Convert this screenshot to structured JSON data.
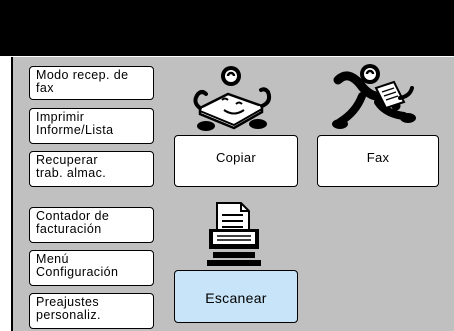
{
  "side_menu": {
    "items": [
      {
        "label": "Modo recep. de\nfax"
      },
      {
        "label": "Imprimir\nInforme/Lista"
      },
      {
        "label": "Recuperar\ntrab. almac."
      },
      {
        "label": "Contador de\nfacturación"
      },
      {
        "label": "Menú\nConfiguración"
      },
      {
        "label": "Preajustes\npersonaliz."
      }
    ]
  },
  "functions": {
    "copy": {
      "label": "Copiar",
      "icon": "copier-character-icon"
    },
    "fax": {
      "label": "Fax",
      "icon": "running-fax-character-icon"
    },
    "scan": {
      "label": "Escanear",
      "icon": "scanner-computer-icon",
      "selected": true
    }
  },
  "colors": {
    "header": "#000000",
    "panel": "#c0c0c0",
    "button": "#ffffff",
    "selected_button": "#c8e4f8"
  }
}
